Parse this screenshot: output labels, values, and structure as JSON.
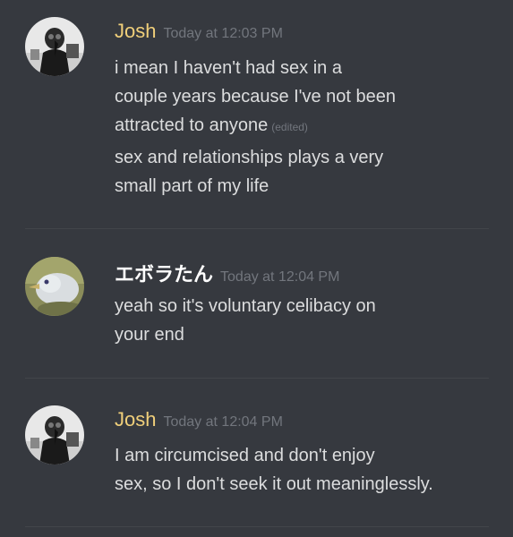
{
  "messages": [
    {
      "author": "Josh",
      "timestamp": "Today at 12:03 PM",
      "avatar_icon": "mask-avatar-icon",
      "blocks": [
        {
          "lines": [
            "i mean I haven't had sex in a",
            "couple years because I've not been",
            "attracted to anyone"
          ],
          "edited_label": "(edited)"
        },
        {
          "lines": [
            "sex and relationships plays a very",
            "small part of my life"
          ]
        }
      ]
    },
    {
      "author": "エボラたん",
      "timestamp": "Today at 12:04 PM",
      "avatar_icon": "bird-avatar-icon",
      "blocks": [
        {
          "lines": [
            "yeah so it's voluntary celibacy on",
            "your end"
          ]
        }
      ]
    },
    {
      "author": "Josh",
      "timestamp": "Today at 12:04 PM",
      "avatar_icon": "mask-avatar-icon",
      "blocks": [
        {
          "lines": [
            "I am circumcised and don't enjoy",
            "sex, so I don't seek it out meaninglessly."
          ]
        }
      ]
    }
  ],
  "colors": {
    "background": "#36393f",
    "josh_name": "#f0cf7a",
    "ebola_name": "#ffffff",
    "timestamp": "#72767d",
    "message_text": "#dcddde",
    "divider": "#42454a"
  }
}
